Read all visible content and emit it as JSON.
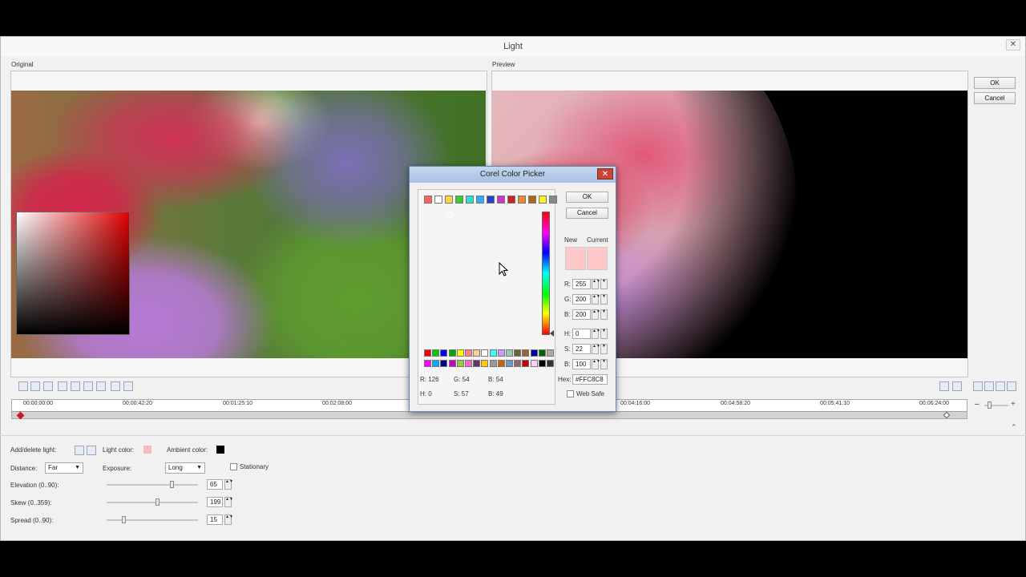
{
  "window": {
    "title": "Light",
    "close": "✕",
    "ok_label": "OK",
    "cancel_label": "Cancel"
  },
  "original": {
    "label": "Original"
  },
  "preview": {
    "label": "Preview"
  },
  "timeline": {
    "ticks": [
      "00:00:00:00",
      "00:00:42:20",
      "00:01:25:10",
      "00:02:08:00",
      "00:04:16:00",
      "00:04:58:20",
      "00:05:41:10",
      "00:06:24:00"
    ]
  },
  "controls": {
    "add_delete_label": "Add/delete light:",
    "light_color_label": "Light color:",
    "light_color": "#f4bcc0",
    "ambient_color_label": "Ambient color:",
    "ambient_color": "#000000",
    "distance_label": "Distance:",
    "distance_value": "Far",
    "exposure_label": "Exposure:",
    "exposure_value": "Long",
    "stationary_label": "Stationary",
    "elevation_label": "Elevation (0..90):",
    "elevation_value": "65",
    "elevation_level": 0.72,
    "skew_label": "Skew (0..359):",
    "skew_value": "199",
    "skew_level": 0.55,
    "spread_label": "Spread (0..90):",
    "spread_value": "15",
    "spread_level": 0.17
  },
  "picker": {
    "title": "Corel Color Picker",
    "close": "✕",
    "ok_label": "OK",
    "cancel_label": "Cancel",
    "new_label": "New",
    "current_label": "Current",
    "new_color": "#ffc8c8",
    "current_color": "#ffc8c8",
    "r_label": "R:",
    "r_value": "255",
    "g_label": "G:",
    "g_value": "200",
    "b_label": "B:",
    "b_value": "200",
    "h_label": "H:",
    "h_value": "0",
    "s_label": "S:",
    "s_value": "22",
    "bv_label": "B:",
    "bv_value": "100",
    "hex_label": "Hex:",
    "hex_value": "#FFC8C8",
    "web_safe_label": "Web Safe",
    "readout_r": "R: 126",
    "readout_g": "G: 54",
    "readout_b": "B: 54",
    "readout_h": "H: 0",
    "readout_s": "S: 57",
    "readout_bv": "B: 49",
    "top_swatches": [
      "#ff6060",
      "#ffffff",
      "#ffd24a",
      "#33cc33",
      "#33ddcc",
      "#33aaff",
      "#2244cc",
      "#cc33cc",
      "#cc2222",
      "#ee8833",
      "#aa6622",
      "#ffee22",
      "#888888"
    ],
    "palette_row1": [
      "#ff0000",
      "#00cc00",
      "#0000ff",
      "#00aa00",
      "#ffff00",
      "#ff8080",
      "#ffcc99",
      "#ffffff",
      "#33ffff",
      "#cc99ff",
      "#99ccaa",
      "#666633",
      "#996633",
      "#0000aa",
      "#006600",
      "#aaaaaa"
    ],
    "palette_row2": [
      "#ff00ff",
      "#00aaff",
      "#000088",
      "#cc00cc",
      "#99cc33",
      "#ff66cc",
      "#663366",
      "#ffcc00",
      "#999999",
      "#cc6600",
      "#6699cc",
      "#996666",
      "#cc0000",
      "#ffccff",
      "#000000",
      "#333333"
    ]
  }
}
